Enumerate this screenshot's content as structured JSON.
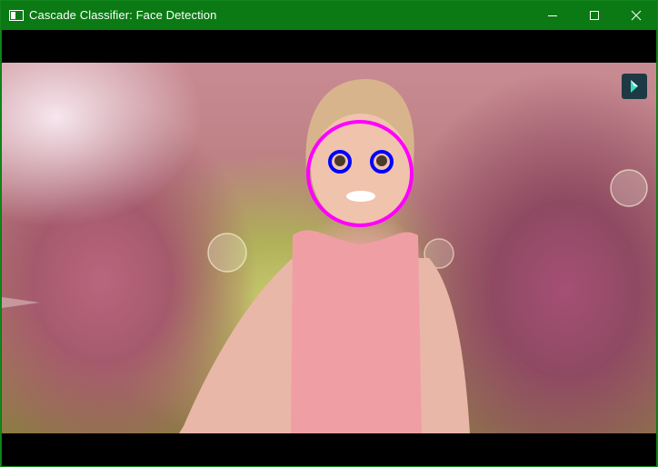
{
  "window": {
    "title": "Cascade Classifier: Face Detection",
    "icons": {
      "app": "app-window-icon",
      "minimize": "minimize-icon",
      "maximize": "maximize-icon",
      "close": "close-icon",
      "edit": "pen-edit-icon"
    }
  },
  "detection": {
    "face_outline_color": "#ff00ff",
    "eye_outline_color": "#0000ff"
  },
  "colors": {
    "titlebar": "#0b7a14",
    "letterbox": "#000000"
  }
}
